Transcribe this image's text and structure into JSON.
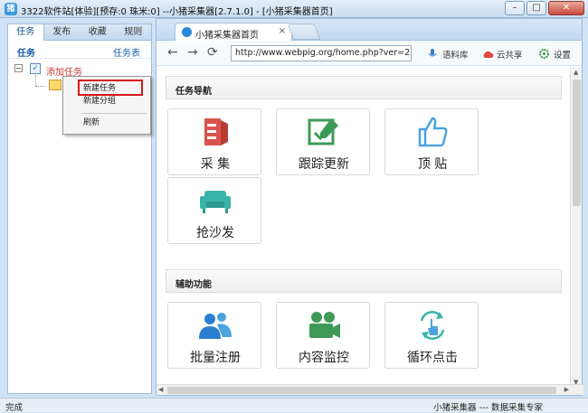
{
  "window": {
    "title": "3322软件站[体验][预存:0 珠米:0] --小猪采集器[2.7.1.0] - [小猪采集器首页]",
    "buttons": {
      "minimize": "–",
      "maximize": "□",
      "close": "✕"
    }
  },
  "left_panel": {
    "tabs": [
      "任务",
      "发布",
      "收藏",
      "规则"
    ],
    "sub_title": "任务",
    "sub_link": "任务表",
    "tree": {
      "expander": "−",
      "root_label": "添加任务",
      "checked": true
    },
    "context_menu": [
      "新建任务",
      "新建分组",
      "刷新"
    ]
  },
  "browser": {
    "tab_title": "小猪采集器首页",
    "tab_close": "×",
    "nav": {
      "back": "←",
      "forward": "→",
      "refresh": "⟳"
    },
    "url": "http://www.webpig.org/home.php?ver=2.7.1.0",
    "toolbar_items": [
      "语料库",
      "云共享",
      "设置"
    ]
  },
  "content": {
    "section1_title": "任务导航",
    "section1_cards": [
      "采 集",
      "跟踪更新",
      "顶 贴",
      "抢沙发"
    ],
    "section2_title": "辅助功能",
    "section2_cards": [
      "批量注册",
      "内容监控",
      "循环点击"
    ]
  },
  "statusbar": {
    "left": "完成",
    "right": "小猪采集器 --- 数据采集专家"
  },
  "colors": {
    "accent": "#1d5eab",
    "highlight": "#d7161b",
    "icon_red": "#d9534f",
    "icon_green": "#3f9a57",
    "icon_blue": "#4aa3df",
    "icon_teal": "#3ab3a8"
  }
}
